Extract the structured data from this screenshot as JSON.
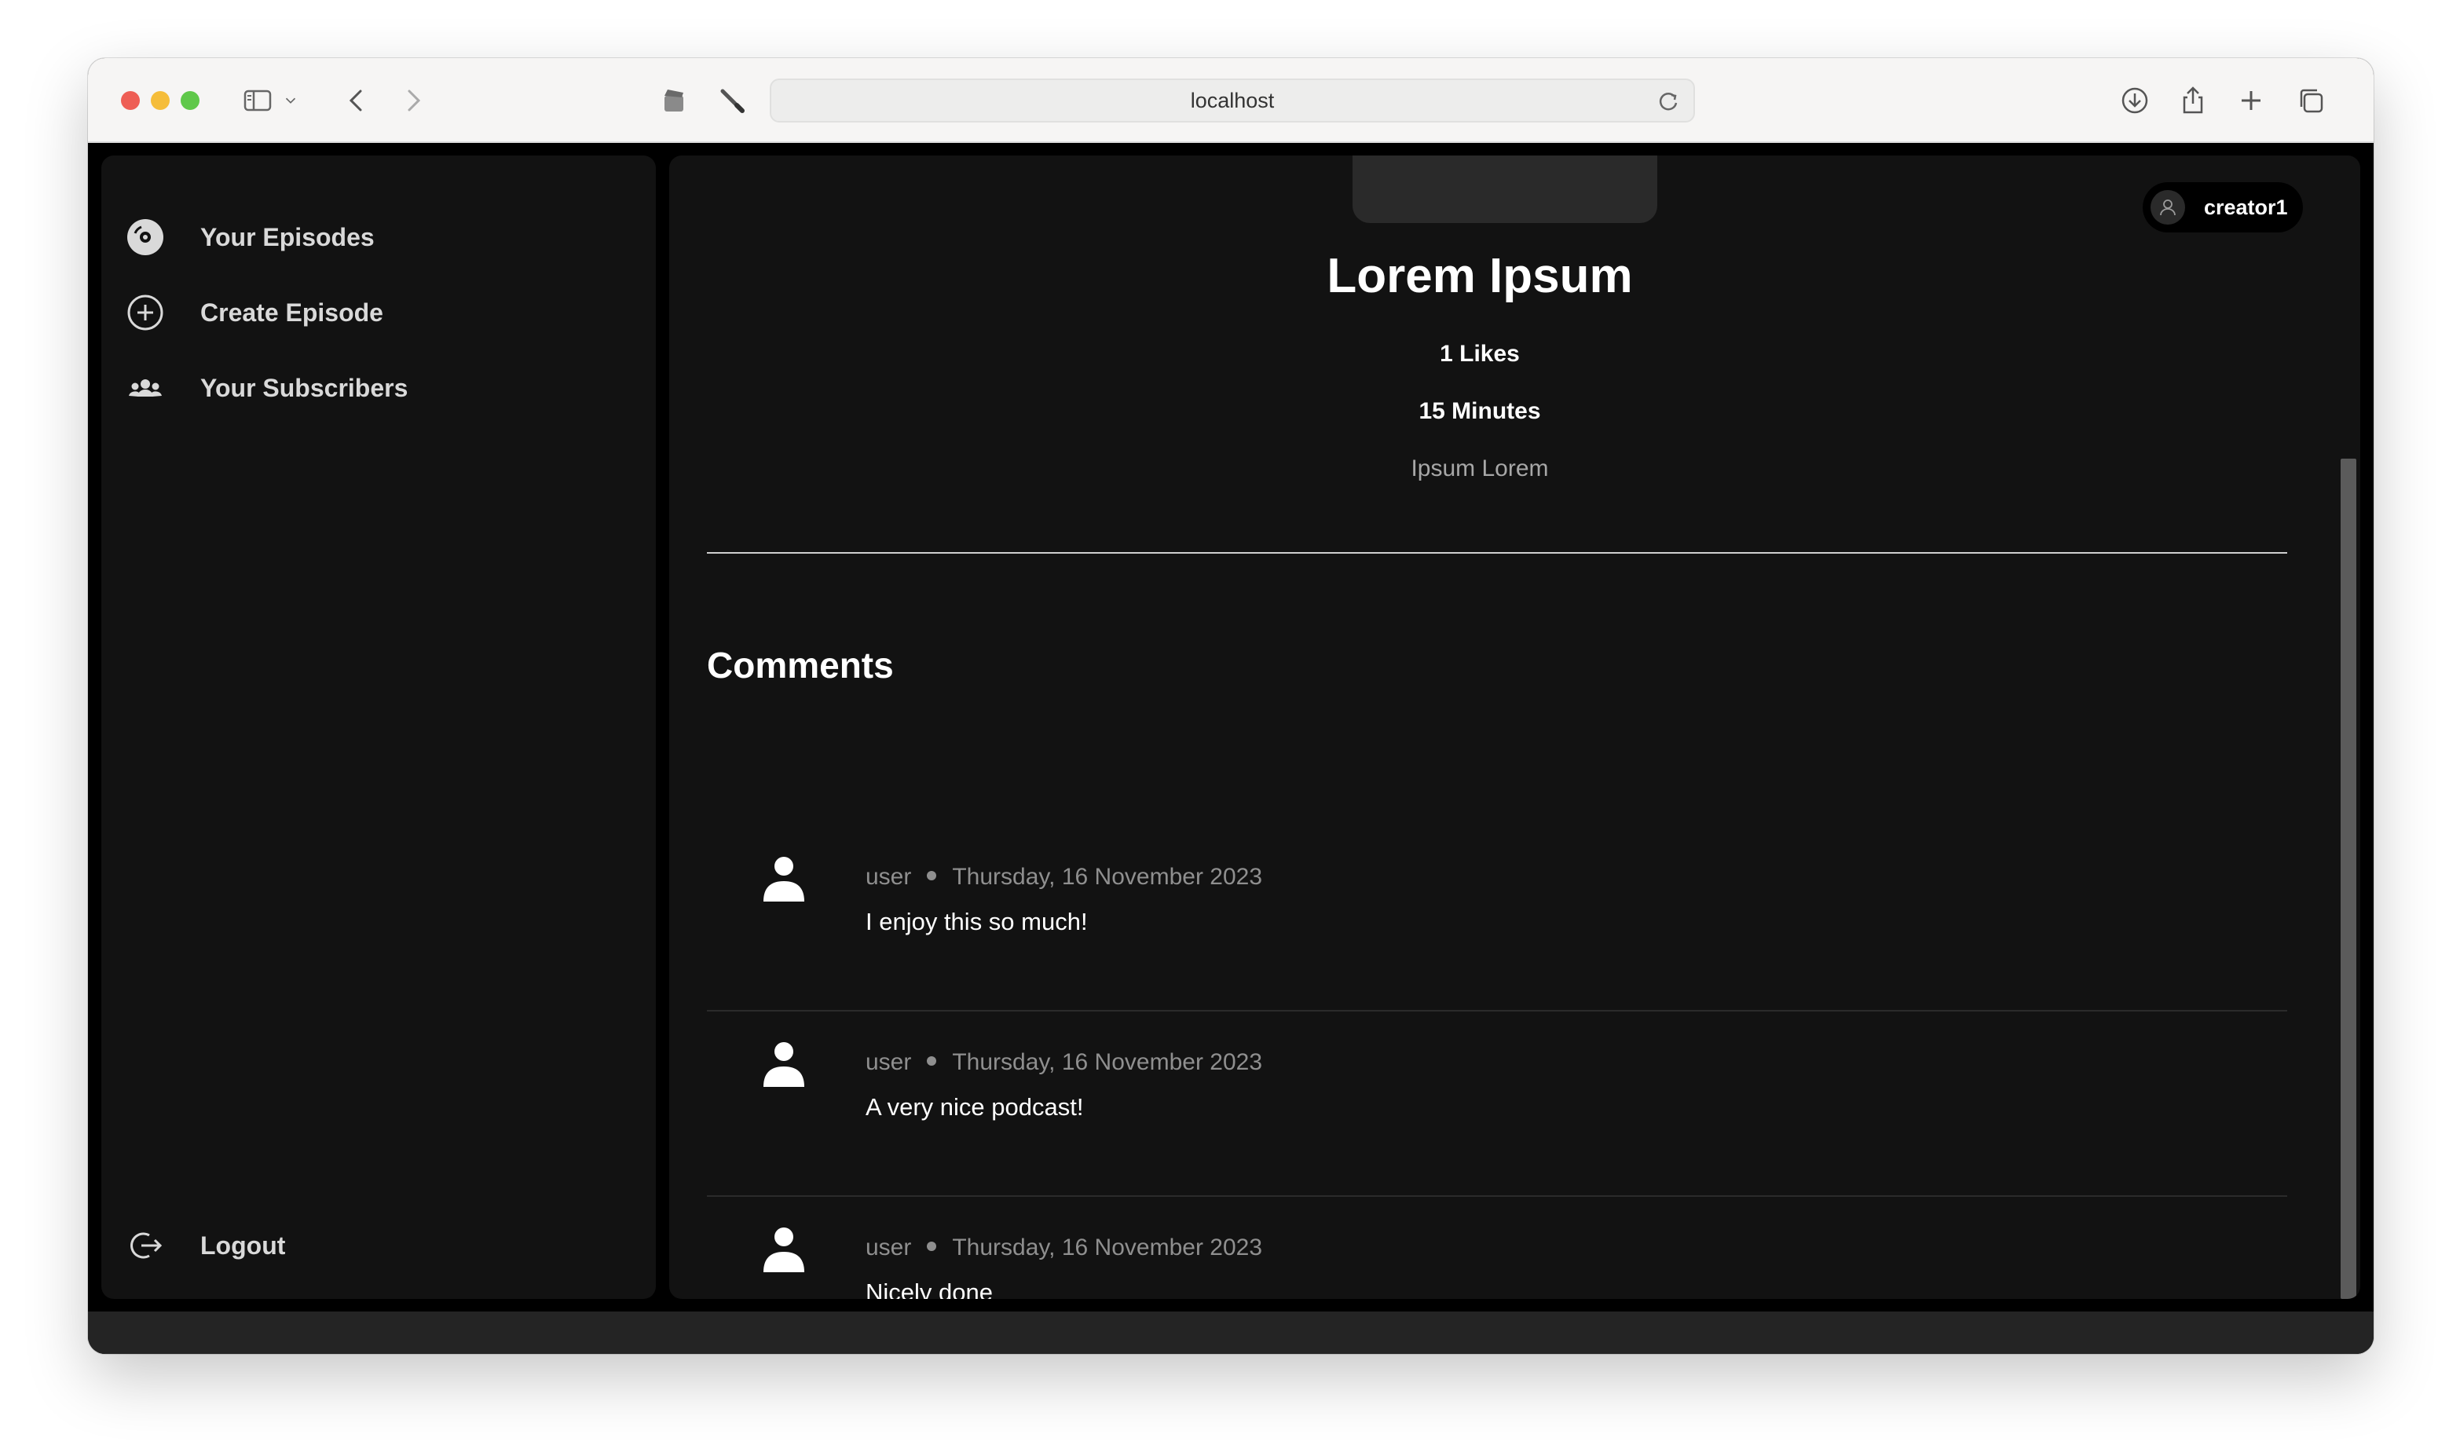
{
  "browser": {
    "url": "localhost"
  },
  "sidebar": {
    "items": [
      {
        "label": "Your Episodes",
        "icon": "disc-icon"
      },
      {
        "label": "Create Episode",
        "icon": "plus-circle-icon"
      },
      {
        "label": "Your Subscribers",
        "icon": "group-icon"
      }
    ],
    "logout": {
      "label": "Logout",
      "icon": "logout-icon"
    }
  },
  "header": {
    "username": "creator1"
  },
  "episode": {
    "title": "Lorem Ipsum",
    "likes": "1 Likes",
    "duration": "15 Minutes",
    "description": "Ipsum Lorem"
  },
  "comments": {
    "heading": "Comments",
    "items": [
      {
        "user": "user",
        "date": "Thursday, 16 November 2023",
        "text": "I enjoy this so much!"
      },
      {
        "user": "user",
        "date": "Thursday, 16 November 2023",
        "text": "A very nice podcast!"
      },
      {
        "user": "user",
        "date": "Thursday, 16 November 2023",
        "text": "Nicely done"
      }
    ]
  },
  "colors": {
    "background": "#000000",
    "panel": "#121212",
    "text_primary": "#ffffff",
    "text_secondary": "#a7a7a7"
  }
}
